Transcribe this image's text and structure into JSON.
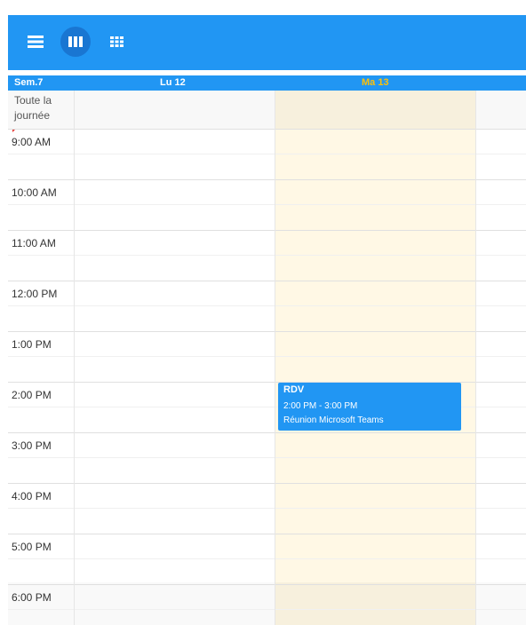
{
  "toolbar": {
    "views": [
      {
        "icon": "list-view-icon",
        "active": false
      },
      {
        "icon": "week-view-icon",
        "active": true
      },
      {
        "icon": "month-view-icon",
        "active": false
      }
    ]
  },
  "header": {
    "week_label": "Sem.7",
    "days": [
      {
        "label": "Lu 12",
        "today": false
      },
      {
        "label": "Ma 13",
        "today": true
      }
    ],
    "today_color": "#ffc107"
  },
  "allday_label_1": "Toute la",
  "allday_label_2": "journée",
  "hours": [
    "9:00 AM",
    "10:00 AM",
    "11:00 AM",
    "12:00 PM",
    "1:00 PM",
    "2:00 PM",
    "3:00 PM",
    "4:00 PM",
    "5:00 PM",
    "6:00 PM"
  ],
  "event": {
    "title": "RDV",
    "time_range": "2:00 PM - 3:00 PM",
    "subject": "Réunion Microsoft Teams",
    "color": "#2196f3"
  }
}
